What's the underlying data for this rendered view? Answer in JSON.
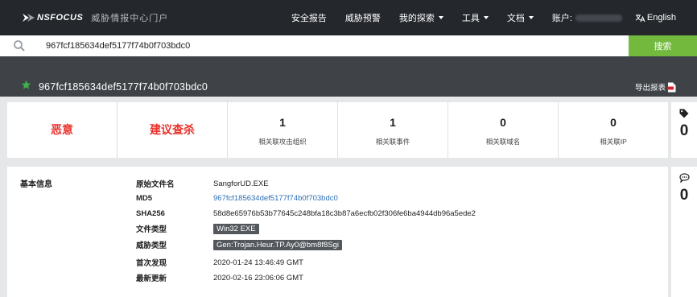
{
  "nav": {
    "logo_text": "NSFOCUS",
    "portal_name": "威胁情报中心门户",
    "items": [
      {
        "label": "安全报告"
      },
      {
        "label": "威胁预警"
      },
      {
        "label": "我的探索"
      },
      {
        "label": "工具"
      },
      {
        "label": "文档"
      }
    ],
    "account_label": "账户:",
    "language": "English",
    "language_icon": "translate-icon"
  },
  "search": {
    "value": "967fcf185634def5177f74b0f703bdc0",
    "button_label": "搜索",
    "icon": "search-icon"
  },
  "header": {
    "title": "967fcf185634def5177f74b0f703bdc0",
    "export_label": "导出报表",
    "star_color": "#3fb04a"
  },
  "summary": {
    "verdict": "恶意",
    "recommendation": "建议查杀",
    "stats": [
      {
        "value": "1",
        "label": "相关联攻击组织"
      },
      {
        "value": "1",
        "label": "相关联事件"
      },
      {
        "value": "0",
        "label": "相关联域名"
      },
      {
        "value": "0",
        "label": "相关联IP"
      }
    ],
    "alert_color": "#e8312a"
  },
  "side": {
    "tags_count": "0",
    "comments_count": "0"
  },
  "info": {
    "heading": "基本信息",
    "rows": [
      {
        "label": "原始文件名",
        "value": "SangforUD.EXE"
      },
      {
        "label": "MD5",
        "value": "967fcf185634def5177f74b0f703bdc0"
      },
      {
        "label": "SHA256",
        "value": "58d8e65976b53b77645c248bfa18c3b87a6ecfb02f306fe6ba4944db96a5ede2"
      },
      {
        "label": "文件类型",
        "value": "Win32 EXE"
      },
      {
        "label": "威胁类型",
        "value": "Gen:Trojan.Heur.TP.Ay0@bm8f8Sgi"
      },
      {
        "label": "首次发现",
        "value": "2020-01-24 13:46:49 GMT"
      },
      {
        "label": "最新更新",
        "value": "2020-02-16 23:06:06 GMT"
      }
    ]
  }
}
